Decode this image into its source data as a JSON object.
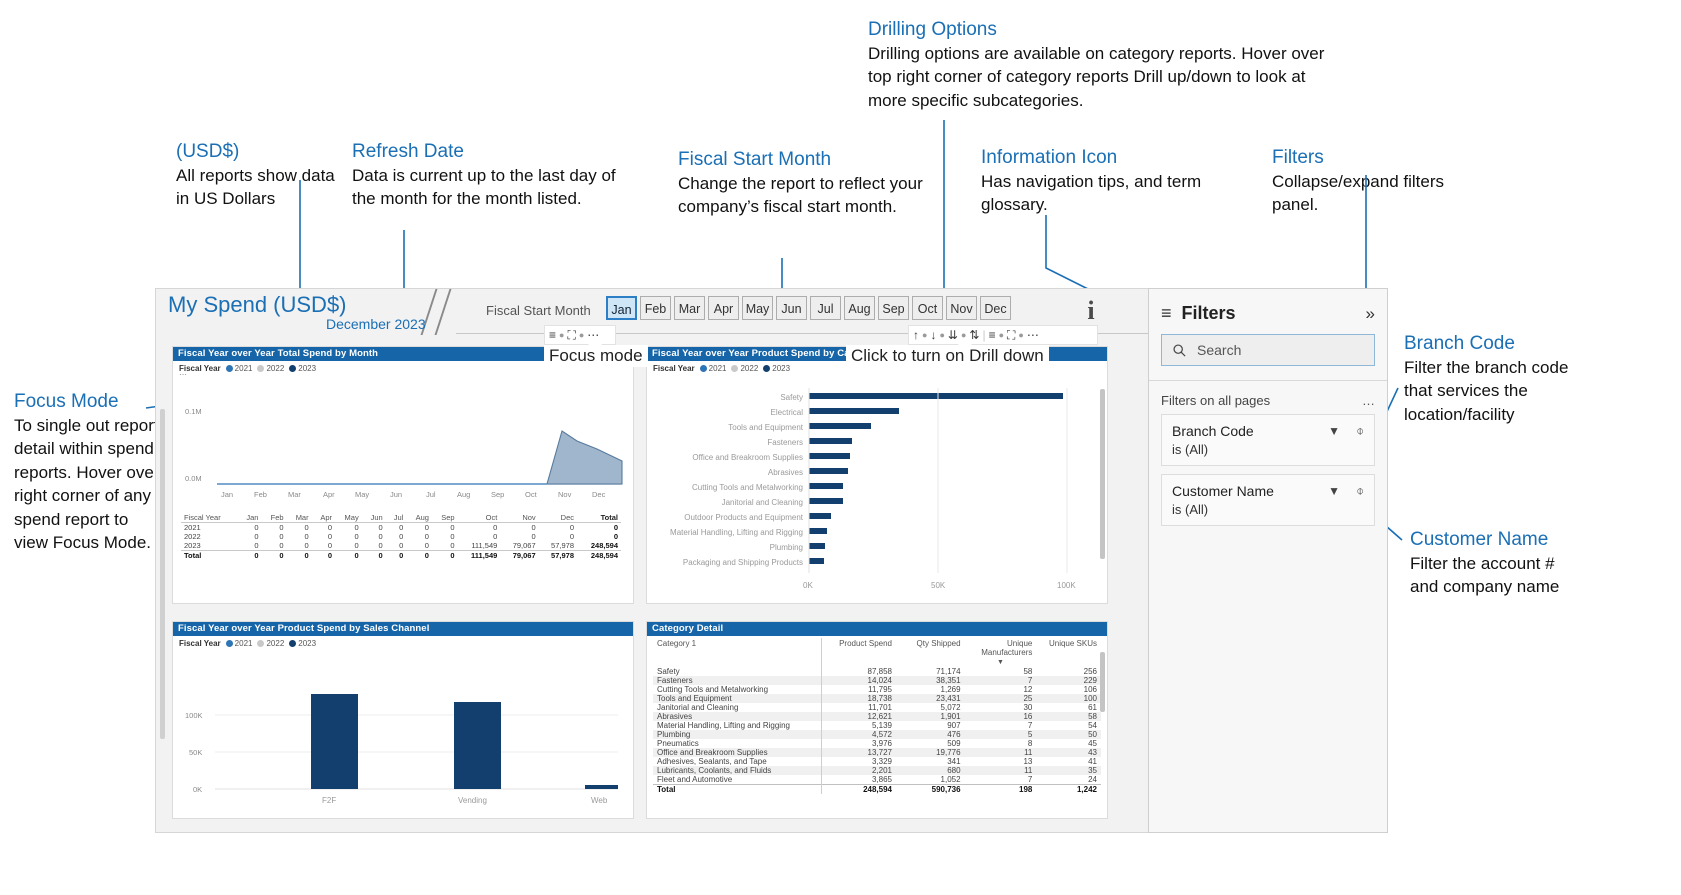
{
  "annotations": [
    {
      "id": "usd",
      "title": "(USD$)",
      "body": "All reports show data in US Dollars"
    },
    {
      "id": "refresh",
      "title": "Refresh Date",
      "body": "Data is current up to the last day of the month for the month listed."
    },
    {
      "id": "fiscal",
      "title": "Fiscal Start Month",
      "body": "Change the report to reflect your company’s fiscal start month."
    },
    {
      "id": "info",
      "title": "Information Icon",
      "body": "Has navigation tips, and term glossary."
    },
    {
      "id": "filters",
      "title": "Filters",
      "body": "Collapse/expand filters panel."
    },
    {
      "id": "drilling",
      "title": "Drilling Options",
      "body": "Drilling options are available on category reports. Hover over top right corner of category reports Drill up/down to look at more specific subcategories."
    },
    {
      "id": "focus",
      "title": "Focus Mode",
      "body": "To single out report detail within spend reports. Hover over right corner of any spend report to view Focus Mode."
    },
    {
      "id": "branch",
      "title": "Branch Code",
      "body": "Filter the branch code that services the location/facility"
    },
    {
      "id": "customer",
      "title": "Customer Name",
      "body": "Filter the account # and company name"
    }
  ],
  "report": {
    "title": "My Spend (USD$)",
    "date": "December  2023",
    "fiscal_start_label": "Fiscal Start Month",
    "months": [
      "Jan",
      "Feb",
      "Mar",
      "Apr",
      "May",
      "Jun",
      "Jul",
      "Aug",
      "Sep",
      "Oct",
      "Nov",
      "Dec"
    ],
    "selected_month": "Jan",
    "info_icon": "i",
    "overlays": {
      "focus_mode": "Focus mode",
      "drill_down": "Click to turn on Drill down"
    }
  },
  "visuals": {
    "total_spend_by_month": {
      "title": "Fiscal Year over Year Total Spend by Month",
      "legend_label": "Fiscal Year",
      "legend": [
        {
          "name": "2021",
          "color": "#2e75b6"
        },
        {
          "name": "2022",
          "color": "#c9c9c9"
        },
        {
          "name": "2023",
          "color": "#123f6d"
        }
      ],
      "chart_data": {
        "type": "area",
        "title": "Fiscal Year over Year Total Spend by Month",
        "categories": [
          "Jan",
          "Feb",
          "Mar",
          "Apr",
          "May",
          "Jun",
          "Jul",
          "Aug",
          "Sep",
          "Oct",
          "Nov",
          "Dec"
        ],
        "series": [
          {
            "name": "2023",
            "values": [
              0,
              0,
              0,
              0,
              0,
              0,
              0,
              0,
              0,
              111549,
              79067,
              57978
            ]
          }
        ],
        "ylabel": "",
        "xlabel": "",
        "ytick_labels": [
          "0.0M",
          "0.1M"
        ],
        "ylim": [
          0,
          130000
        ],
        "grid": false,
        "legend_position": "top-left"
      },
      "table": {
        "columns": [
          "Fiscal Year",
          "Jan",
          "Feb",
          "Mar",
          "Apr",
          "May",
          "Jun",
          "Jul",
          "Aug",
          "Sep",
          "Oct",
          "Nov",
          "Dec",
          "Total"
        ],
        "rows": [
          [
            "2021",
            "0",
            "0",
            "0",
            "0",
            "0",
            "0",
            "0",
            "0",
            "0",
            "0",
            "0",
            "0",
            "0"
          ],
          [
            "2022",
            "0",
            "0",
            "0",
            "0",
            "0",
            "0",
            "0",
            "0",
            "0",
            "0",
            "0",
            "0",
            "0"
          ],
          [
            "2023",
            "0",
            "0",
            "0",
            "0",
            "0",
            "0",
            "0",
            "0",
            "0",
            "111,549",
            "79,067",
            "57,978",
            "248,594"
          ],
          [
            "Total",
            "0",
            "0",
            "0",
            "0",
            "0",
            "0",
            "0",
            "0",
            "0",
            "111,549",
            "79,067",
            "57,978",
            "248,594"
          ]
        ]
      }
    },
    "product_spend_by_category": {
      "title": "Fiscal Year over Year Product Spend by Category",
      "legend_label": "Fiscal Year",
      "legend": [
        {
          "name": "2021",
          "color": "#2e75b6"
        },
        {
          "name": "2022",
          "color": "#c9c9c9"
        },
        {
          "name": "2023",
          "color": "#123f6d"
        }
      ],
      "chart_data": {
        "type": "bar",
        "orientation": "horizontal",
        "title": "Fiscal Year over Year Product Spend by Category",
        "categories": [
          "Safety",
          "Electrical",
          "Tools and Equipment",
          "Fasteners",
          "Office and Breakroom Supplies",
          "Abrasives",
          "Cutting Tools and Metalworking",
          "Janitorial and Cleaning",
          "Outdoor Products and Equipment",
          "Material Handling, Lifting and Rigging",
          "Plumbing",
          "Packaging and Shipping Products"
        ],
        "values": [
          87858,
          31000,
          21000,
          14024,
          13727,
          12621,
          11795,
          11701,
          5800,
          5139,
          4572,
          4300
        ],
        "xtick_labels": [
          "0K",
          "50K",
          "100K"
        ],
        "xlim": [
          0,
          100000
        ],
        "series_name": "2023",
        "grid": false
      }
    },
    "product_spend_by_sales_channel": {
      "title": "Fiscal Year over Year Product Spend by Sales Channel",
      "legend_label": "Fiscal Year",
      "legend": [
        {
          "name": "2021",
          "color": "#2e75b6"
        },
        {
          "name": "2022",
          "color": "#c9c9c9"
        },
        {
          "name": "2023",
          "color": "#123f6d"
        }
      ],
      "chart_data": {
        "type": "bar",
        "orientation": "vertical",
        "title": "Fiscal Year over Year Product Spend by Sales Channel",
        "categories": [
          "F2F",
          "Vending",
          "Web"
        ],
        "values": [
          128000,
          117000,
          5000
        ],
        "ytick_labels": [
          "0K",
          "50K",
          "100K"
        ],
        "ylim": [
          0,
          140000
        ],
        "series_name": "2023",
        "grid": true
      }
    },
    "category_detail": {
      "title": "Category Detail",
      "columns": [
        "Category 1",
        "Product Spend",
        "Qty Shipped",
        "Unique Manufacturers",
        "Unique SKUs"
      ],
      "sorted_column": "Unique SKUs",
      "rows": [
        [
          "Safety",
          "87,858",
          "71,174",
          "58",
          "256"
        ],
        [
          "Fasteners",
          "14,024",
          "38,351",
          "7",
          "229"
        ],
        [
          "Cutting Tools and Metalworking",
          "11,795",
          "1,269",
          "12",
          "106"
        ],
        [
          "Tools and Equipment",
          "18,738",
          "23,431",
          "25",
          "100"
        ],
        [
          "Janitorial and Cleaning",
          "11,701",
          "5,072",
          "30",
          "61"
        ],
        [
          "Abrasives",
          "12,621",
          "1,901",
          "16",
          "58"
        ],
        [
          "Material Handling, Lifting and Rigging",
          "5,139",
          "907",
          "7",
          "54"
        ],
        [
          "Plumbing",
          "4,572",
          "476",
          "5",
          "50"
        ],
        [
          "Pneumatics",
          "3,976",
          "509",
          "8",
          "45"
        ],
        [
          "Office and Breakroom Supplies",
          "13,727",
          "19,776",
          "11",
          "43"
        ],
        [
          "Adhesives, Sealants, and Tape",
          "3,329",
          "341",
          "13",
          "41"
        ],
        [
          "Lubricants, Coolants, and Fluids",
          "2,201",
          "680",
          "11",
          "35"
        ],
        [
          "Fleet and Automotive",
          "3,865",
          "1,052",
          "7",
          "24"
        ]
      ],
      "total_row": [
        "Total",
        "248,594",
        "590,736",
        "198",
        "1,242"
      ]
    }
  },
  "filters_pane": {
    "title": "Filters",
    "collapse_icon": "»",
    "search_placeholder": "Search",
    "section_label": "Filters on all pages",
    "more_icon": "…",
    "cards": [
      {
        "name": "Branch Code",
        "value": "is (All)"
      },
      {
        "name": "Customer Name",
        "value": "is (All)"
      }
    ]
  },
  "colors": {
    "accent_blue": "#1a6fb5",
    "header_blue": "#1565a8",
    "bar_dark": "#123f6d",
    "area_fill": "#9fb6cc"
  }
}
